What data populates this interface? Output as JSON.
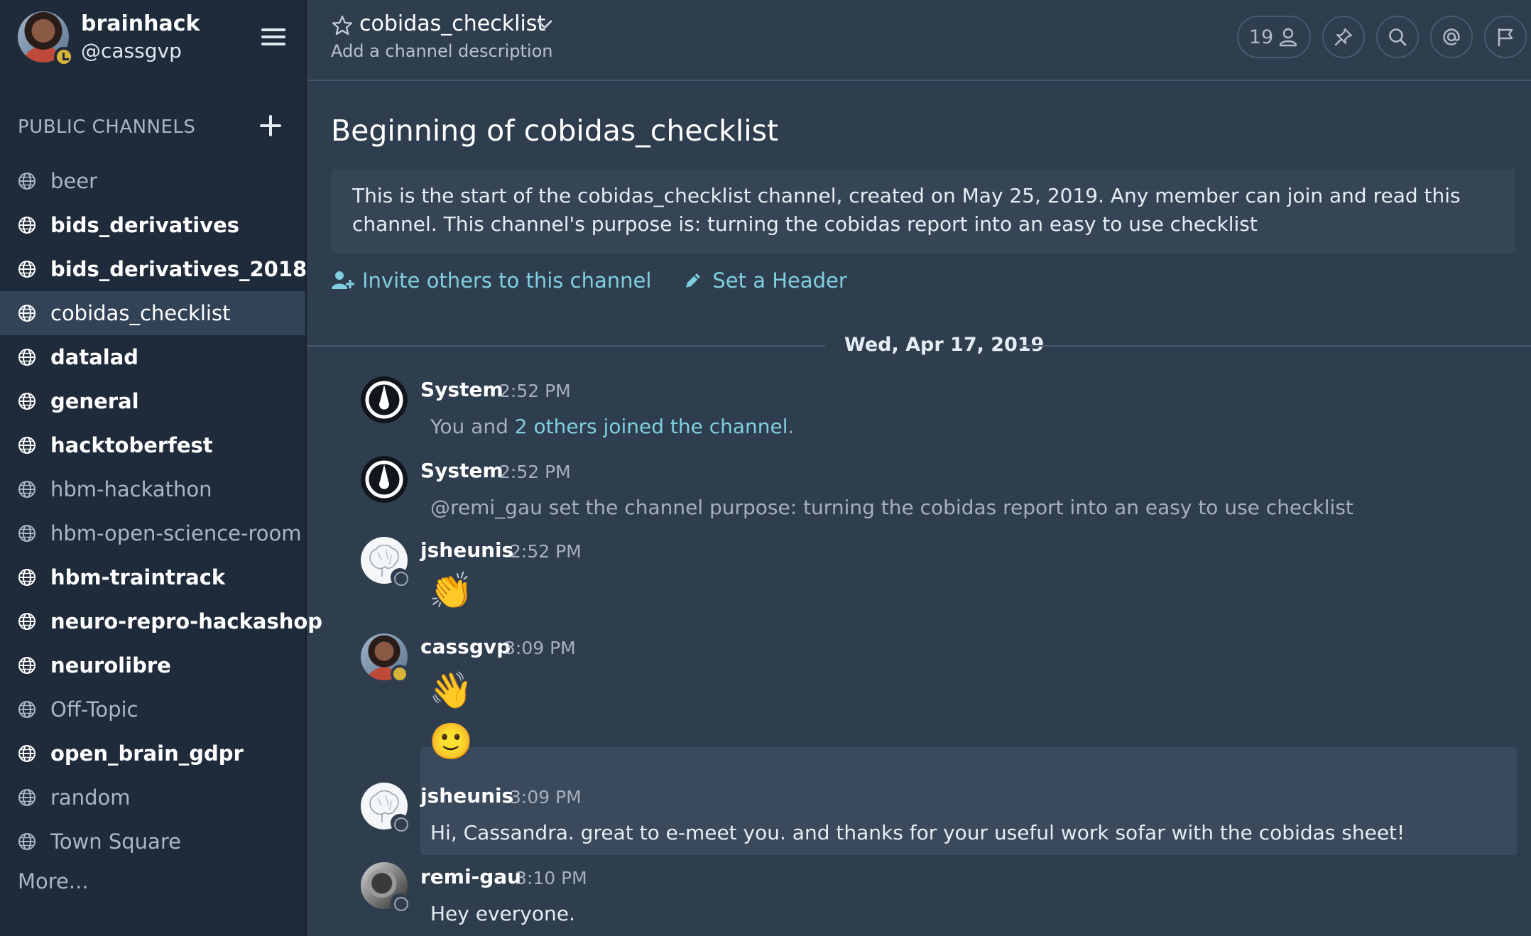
{
  "team": {
    "name": "brainhack",
    "username": "@cassgvp"
  },
  "sidebar": {
    "section_title": "PUBLIC CHANNELS",
    "channels": [
      {
        "name": "beer",
        "state": "read"
      },
      {
        "name": "bids_derivatives",
        "state": "unread"
      },
      {
        "name": "bids_derivatives_2018",
        "state": "unread"
      },
      {
        "name": "cobidas_checklist",
        "state": "active"
      },
      {
        "name": "datalad",
        "state": "unread"
      },
      {
        "name": "general",
        "state": "unread"
      },
      {
        "name": "hacktoberfest",
        "state": "unread"
      },
      {
        "name": "hbm-hackathon",
        "state": "read"
      },
      {
        "name": "hbm-open-science-room",
        "state": "read"
      },
      {
        "name": "hbm-traintrack",
        "state": "unread"
      },
      {
        "name": "neuro-repro-hackashop",
        "state": "unread"
      },
      {
        "name": "neurolibre",
        "state": "unread"
      },
      {
        "name": "Off-Topic",
        "state": "read"
      },
      {
        "name": "open_brain_gdpr",
        "state": "unread"
      },
      {
        "name": "random",
        "state": "read"
      },
      {
        "name": "Town Square",
        "state": "read"
      }
    ],
    "more_label": "More..."
  },
  "header": {
    "channel_name": "cobidas_checklist",
    "description": "Add a channel description",
    "member_count": "19",
    "icons": [
      "star-icon",
      "chevron-down-icon",
      "member-icon",
      "pin-icon",
      "search-icon",
      "at-mention-icon",
      "flag-icon"
    ]
  },
  "intro": {
    "title": "Beginning of cobidas_checklist",
    "text": "This is the start of the cobidas_checklist channel, created on May 25, 2019. Any member can join and read this channel. This channel's purpose is: turning the cobidas report into an easy to use checklist",
    "invite_label": "Invite others to this channel",
    "header_label": "Set a Header"
  },
  "date_separator": "Wed, Apr 17, 2019",
  "posts": [
    {
      "user": "System",
      "time": "2:52 PM",
      "text_prefix": "You and ",
      "text_link": "2 others joined the channel",
      "text_suffix": "."
    },
    {
      "user": "System",
      "time": "2:52 PM",
      "text": "@remi_gau set the channel purpose: turning the cobidas report into an easy to use checklist"
    },
    {
      "user": "jsheunis",
      "time": "2:52 PM",
      "emoji": "👏"
    },
    {
      "user": "cassgvp",
      "time": "3:09 PM",
      "emoji": "👋",
      "emoji2": "🙂"
    },
    {
      "user": "jsheunis",
      "time": "3:09 PM",
      "text": "Hi, Cassandra. great to e-meet you. and thanks for your useful work sofar with the cobidas sheet!"
    },
    {
      "user": "remi-gau",
      "time": "3:10 PM",
      "text": "Hey everyone."
    }
  ],
  "colors": {
    "sidebar_bg": "#1f2b3b",
    "center_bg": "#2f3e4e",
    "link": "#7fcfe0",
    "away_status": "#d6b43b"
  }
}
